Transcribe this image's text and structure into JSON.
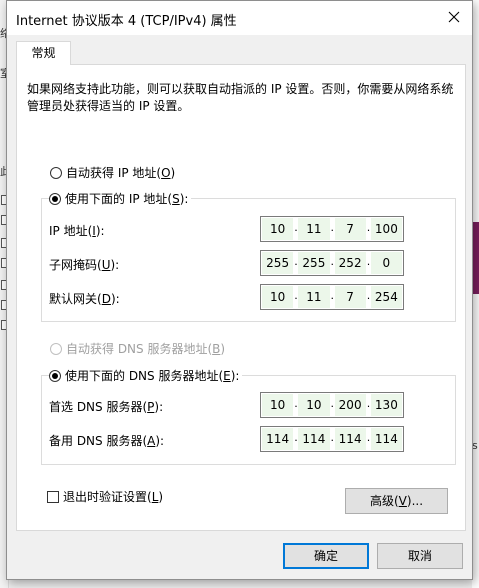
{
  "dialog": {
    "title": "Internet 协议版本 4 (TCP/IPv4) 属性",
    "tab": "常规",
    "description": "如果网络支持此功能，则可以获取自动指派的 IP 设置。否则，你需要从网络系统管理员处获得适当的 IP 设置。",
    "ip_auto": {
      "label": "自动获得 IP 地址(",
      "key": "O",
      "end": ")",
      "selected": false
    },
    "ip_manual": {
      "label": "使用下面的 IP 地址(",
      "key": "S",
      "end": "):",
      "selected": true
    },
    "ip_fields": [
      {
        "label": "IP 地址(",
        "key": "I",
        "end": "):",
        "octets": [
          "10",
          "11",
          "7",
          "100"
        ]
      },
      {
        "label": "子网掩码(",
        "key": "U",
        "end": "):",
        "octets": [
          "255",
          "255",
          "252",
          "0"
        ]
      },
      {
        "label": "默认网关(",
        "key": "D",
        "end": "):",
        "octets": [
          "10",
          "11",
          "7",
          "254"
        ]
      }
    ],
    "dns_auto": {
      "label": "自动获得 DNS 服务器地址(",
      "key": "B",
      "end": ")",
      "selected": false,
      "disabled": true
    },
    "dns_manual": {
      "label": "使用下面的 DNS 服务器地址(",
      "key": "E",
      "end": "):",
      "selected": true
    },
    "dns_fields": [
      {
        "label": "首选 DNS 服务器(",
        "key": "P",
        "end": "):",
        "octets": [
          "10",
          "10",
          "200",
          "130"
        ]
      },
      {
        "label": "备用 DNS 服务器(",
        "key": "A",
        "end": "):",
        "octets": [
          "114",
          "114",
          "114",
          "114"
        ]
      }
    ],
    "validate_on_exit": {
      "label": "退出时验证设置(",
      "key": "L",
      "end": ")",
      "checked": false
    },
    "advanced_button": {
      "label": "高级(",
      "key": "V",
      "end": ")..."
    },
    "ok_button": "确定",
    "cancel_button": "取消"
  },
  "background": {
    "left_marks": [
      "络",
      "室",
      "此"
    ],
    "right_marks": [
      "s"
    ]
  },
  "colors": {
    "accent": "#0078d7",
    "ip_segment_bg": "#ecf7ea",
    "background_window_accent": "#7a1f5e"
  },
  "icons": {
    "close": "close-icon"
  }
}
